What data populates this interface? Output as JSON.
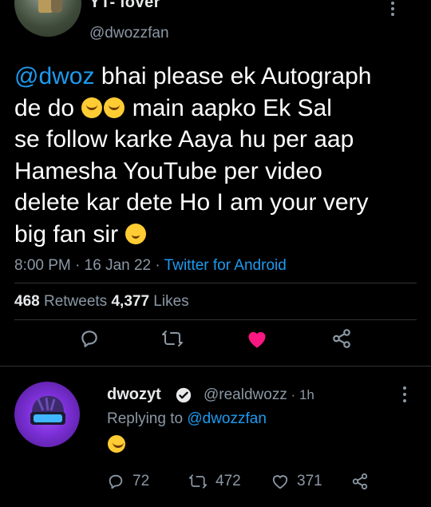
{
  "tweet": {
    "author_name": "YT- lover",
    "author_handle": "@dwozzfan",
    "text_mention": "@dwoz",
    "text_line1_rest": " bhai please ek Autograph",
    "text_line2_a": "de do ",
    "text_line2_b": " main aapko Ek Sal",
    "text_line3": "se follow karke Aaya hu per aap",
    "text_line4": "Hamesha YouTube per video",
    "text_line5": "delete kar dete Ho I am your  very",
    "text_line6": "big fan sir ",
    "time": "8:00 PM",
    "date": "16 Jan 22",
    "source": "Twitter for Android",
    "retweets_count": "468",
    "retweets_label": "Retweets",
    "likes_count": "4,377",
    "likes_label": "Likes",
    "liked": true,
    "colors": {
      "accent": "#1d9bf0",
      "like": "#f91880"
    }
  },
  "reply": {
    "author_name": "dwozyt",
    "verified": true,
    "author_handle": "@realdwozz",
    "time": "1h",
    "replying_prefix": "Replying to",
    "replying_to": "@dwozzfan",
    "reply_count": "72",
    "retweet_count": "472",
    "like_count": "371"
  },
  "icons": [
    "reply-icon",
    "retweet-icon",
    "like-icon",
    "share-icon",
    "more-icon",
    "verified-icon"
  ]
}
